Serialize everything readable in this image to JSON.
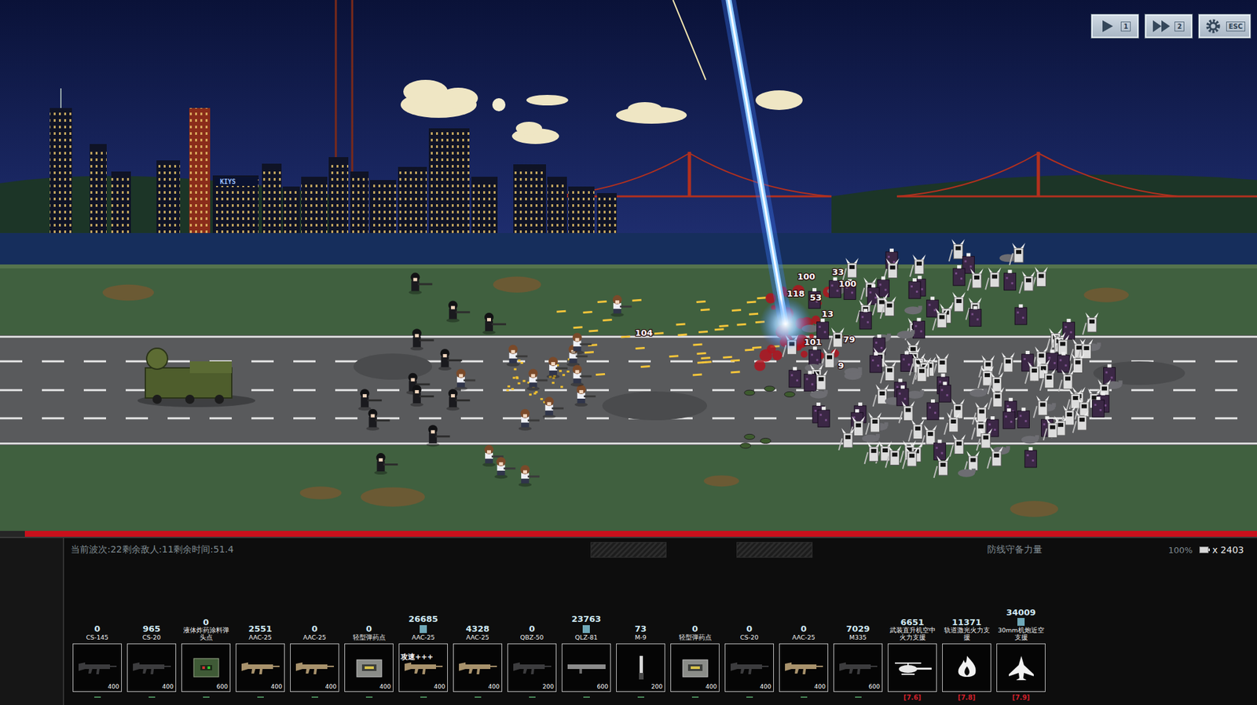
{
  "controls": [
    {
      "kind": "play",
      "label": "1"
    },
    {
      "kind": "fast",
      "label": "2"
    },
    {
      "kind": "gear",
      "label": "ESC"
    }
  ],
  "scene": {
    "billboard": "KIYS",
    "damage_numbers": [
      "100",
      "100",
      "33",
      "118",
      "53",
      "13",
      "104",
      "79",
      "9",
      "101"
    ]
  },
  "defense_bar": {
    "level": 0.98
  },
  "hud": {
    "status": "当前波次:22剩余敌人:11剩余时间:51.4",
    "defense_label": "防线守备力量",
    "percent": "100%",
    "currency": "x 2403"
  },
  "cards": [
    {
      "count": "0",
      "name": "CS-145",
      "cost": "400",
      "kind": "rifle-dark",
      "boosted": false
    },
    {
      "count": "965",
      "name": "CS-20",
      "cost": "400",
      "kind": "rifle-dark",
      "boosted": false
    },
    {
      "count": "0",
      "name": "液体炸药涂料弹头点",
      "cost": "600",
      "kind": "crate-green",
      "boosted": false
    },
    {
      "count": "2551",
      "name": "AAC-25",
      "cost": "400",
      "kind": "rifle-tan",
      "boosted": false
    },
    {
      "count": "0",
      "name": "AAC-25",
      "cost": "400",
      "kind": "rifle-tan",
      "boosted": false
    },
    {
      "count": "0",
      "name": "轻型弹药点",
      "cost": "400",
      "kind": "crate",
      "boosted": false
    },
    {
      "count": "26685",
      "name": "AAC-25",
      "cost": "400",
      "kind": "rifle-tan",
      "boosted": true,
      "tag": "攻速+++"
    },
    {
      "count": "4328",
      "name": "AAC-25",
      "cost": "400",
      "kind": "rifle-tan",
      "boosted": false
    },
    {
      "count": "0",
      "name": "QBZ-50",
      "cost": "200",
      "kind": "rifle-dark",
      "boosted": false
    },
    {
      "count": "23763",
      "name": "QLZ-81",
      "cost": "600",
      "kind": "launcher",
      "boosted": true
    },
    {
      "count": "73",
      "name": "M-9",
      "cost": "200",
      "kind": "blade",
      "boosted": false
    },
    {
      "count": "0",
      "name": "轻型弹药点",
      "cost": "400",
      "kind": "crate",
      "boosted": false
    },
    {
      "count": "0",
      "name": "CS-20",
      "cost": "400",
      "kind": "rifle-dark",
      "boosted": false
    },
    {
      "count": "0",
      "name": "AAC-25",
      "cost": "400",
      "kind": "rifle-tan",
      "boosted": false
    },
    {
      "count": "7029",
      "name": "M335",
      "cost": "600",
      "kind": "rifle-dark",
      "boosted": false
    },
    {
      "count": "6651",
      "name": "武装直升机空中火力支援",
      "kind": "heli",
      "boosted": false,
      "cooldown": "[7.6]"
    },
    {
      "count": "11371",
      "name": "轨道激光火力支援",
      "kind": "flame",
      "boosted": false,
      "cooldown": "[7.8]"
    },
    {
      "count": "34009",
      "name": "30mm机炮近空支援",
      "kind": "jet",
      "boosted": true,
      "cooldown": "[7.9]"
    }
  ]
}
